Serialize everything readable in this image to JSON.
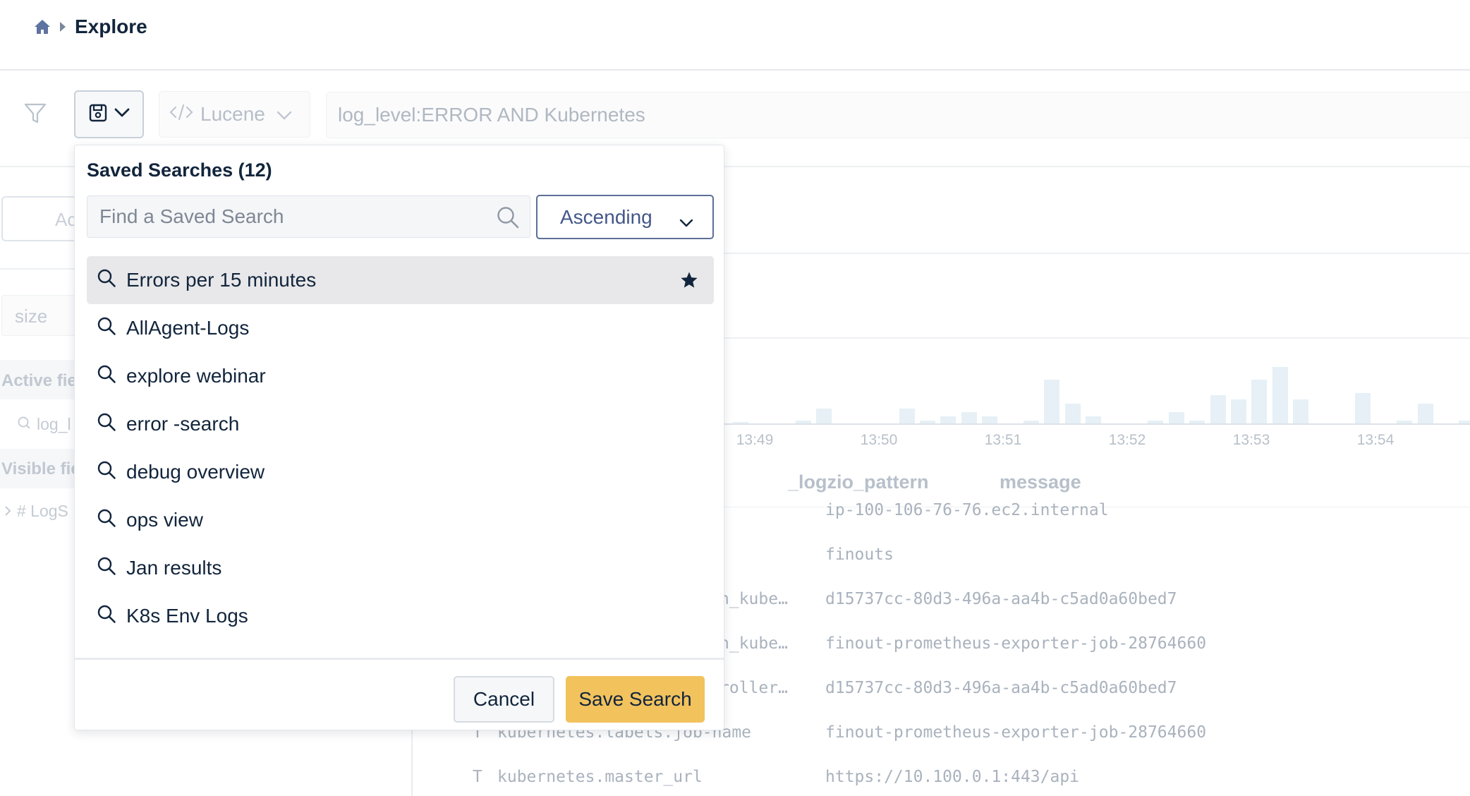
{
  "breadcrumb": {
    "title": "Explore"
  },
  "toolbar": {
    "query_language": "Lucene",
    "query": "log_level:ERROR AND Kubernetes"
  },
  "sidebar": {
    "add_placeholder": "Ac",
    "size_placeholder": "size",
    "active_fields_label": "Active fie",
    "active_field_item": "log_l",
    "visible_fields_label": "Visible fie",
    "visible_field_item": "# LogS"
  },
  "histogram": {
    "bars": [
      0,
      0.02,
      0,
      0,
      0.05,
      0.26,
      0,
      0,
      0,
      0.26,
      0.05,
      0.13,
      0.2,
      0.12,
      0,
      0.05,
      0.77,
      0.35,
      0.12,
      0,
      0,
      0.05,
      0.2,
      0.05,
      0.5,
      0.42,
      0.77,
      1.0,
      0.42,
      0,
      0,
      0.54,
      0,
      0.05,
      0.35,
      0,
      0.05
    ],
    "ticks": [
      "13:49",
      "13:50",
      "13:51",
      "13:52",
      "13:53",
      "13:54"
    ]
  },
  "table": {
    "columns": [
      "_logzio_pattern",
      "message"
    ],
    "rows": [
      {
        "type": "",
        "key": "",
        "value": "ip-100-106-76-76.ec2.internal"
      },
      {
        "type": "",
        "key": "",
        "value": "finouts"
      },
      {
        "type": "",
        "key": "h_kube…",
        "value": "d15737cc-80d3-496a-aa4b-c5ad0a60bed7"
      },
      {
        "type": "",
        "key": "h_kube…",
        "value": "finout-prometheus-exporter-job-28764660"
      },
      {
        "type": "",
        "key": "roller…",
        "value": "d15737cc-80d3-496a-aa4b-c5ad0a60bed7"
      },
      {
        "type": "T",
        "key": "kubernetes.labels.job-name",
        "value": "finout-prometheus-exporter-job-28764660"
      },
      {
        "type": "T",
        "key": "kubernetes.master_url",
        "value": "https://10.100.0.1:443/api"
      }
    ]
  },
  "popover": {
    "title": "Saved Searches (12)",
    "search_placeholder": "Find a Saved Search",
    "sort_label": "Ascending",
    "items": [
      {
        "label": "Errors per 15 minutes",
        "starred": true,
        "selected": true
      },
      {
        "label": "AllAgent-Logs",
        "starred": false,
        "selected": false
      },
      {
        "label": "explore webinar",
        "starred": false,
        "selected": false
      },
      {
        "label": "error -search",
        "starred": false,
        "selected": false
      },
      {
        "label": "debug overview",
        "starred": false,
        "selected": false
      },
      {
        "label": "ops view",
        "starred": false,
        "selected": false
      },
      {
        "label": "Jan results",
        "starred": false,
        "selected": false
      },
      {
        "label": "K8s Env Logs",
        "starred": false,
        "selected": false
      }
    ],
    "cancel_label": "Cancel",
    "save_label": "Save Search"
  },
  "colors": {
    "primary_text": "#12253c",
    "accent_yellow": "#f2c25d",
    "sort_border": "#5b6f98",
    "selected_row": "#e8e8ea"
  }
}
